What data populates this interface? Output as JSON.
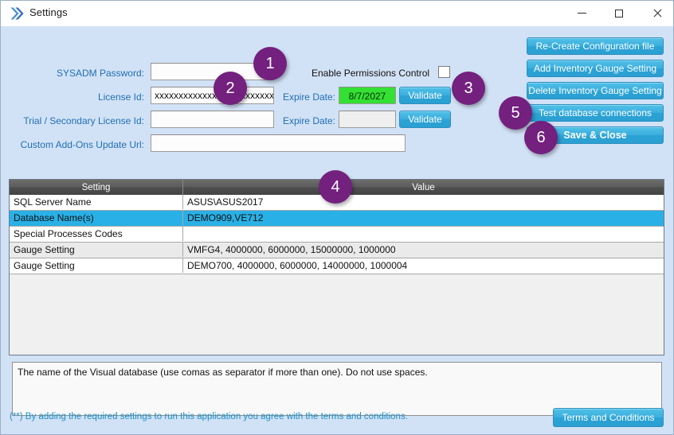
{
  "window": {
    "title": "Settings",
    "icon": "double-chevron-icon",
    "controls": {
      "minimize": "—",
      "maximize": "□",
      "close": "✕"
    }
  },
  "form": {
    "sysadm_password": {
      "label": "SYSADM Password:",
      "value": "",
      "placeholder": ""
    },
    "license_id": {
      "label": "License Id:",
      "value": "xxxxxxxxxxxxxxxxxxxxxxxxx",
      "placeholder": ""
    },
    "trial_license_id": {
      "label": "Trial / Secondary License Id:",
      "value": "",
      "placeholder": ""
    },
    "custom_addons_url": {
      "label": "Custom Add-Ons Update Url:",
      "value": "",
      "placeholder": ""
    },
    "enable_permissions": {
      "label": "Enable  Permissions Control",
      "checked": false
    },
    "expire_date_1": {
      "label": "Expire Date:",
      "value": "8/7/2027",
      "color": "#33e033"
    },
    "expire_date_2": {
      "label": "Expire Date:",
      "value": ""
    },
    "validate_1": "Validate",
    "validate_2": "Validate"
  },
  "action_buttons": [
    {
      "label": "Re-Create Configuration file",
      "bold": false
    },
    {
      "label": "Add Inventory Gauge Setting",
      "bold": false
    },
    {
      "label": "Delete Inventory Gauge Setting",
      "bold": false
    },
    {
      "label": "Test database connections",
      "bold": false
    },
    {
      "label": "Save & Close",
      "bold": true
    }
  ],
  "grid": {
    "columns": [
      "Setting",
      "Value"
    ],
    "rows": [
      {
        "setting": "SQL Server Name",
        "value": "ASUS\\ASUS2017",
        "selected": false,
        "alt": false
      },
      {
        "setting": "Database Name(s)",
        "value": "DEMO909,VE712",
        "selected": true,
        "alt": false
      },
      {
        "setting": "Special Processes Codes",
        "value": "",
        "selected": false,
        "alt": false
      },
      {
        "setting": "Gauge Setting",
        "value": "VMFG4, 4000000, 6000000, 15000000, 1000000",
        "selected": false,
        "alt": true
      },
      {
        "setting": "Gauge Setting",
        "value": "DEMO700, 4000000, 6000000, 14000000, 1000004",
        "selected": false,
        "alt": false
      }
    ]
  },
  "description": "The name of the Visual database (use comas as separator if more than one). Do not use spaces.",
  "footer": {
    "note": "(**) By adding the required settings to run this application you agree with the terms and conditions.",
    "terms_button": "Terms and Conditions"
  },
  "annotations": [
    {
      "number": "1"
    },
    {
      "number": "2"
    },
    {
      "number": "3"
    },
    {
      "number": "4"
    },
    {
      "number": "5"
    },
    {
      "number": "6"
    }
  ],
  "colors": {
    "client_bg": "#d2e2f6",
    "accent_button": "#2ba3d6",
    "badge": "#73207f",
    "selected_row": "#29b0e6",
    "label_blue": "#1f6fb4"
  }
}
